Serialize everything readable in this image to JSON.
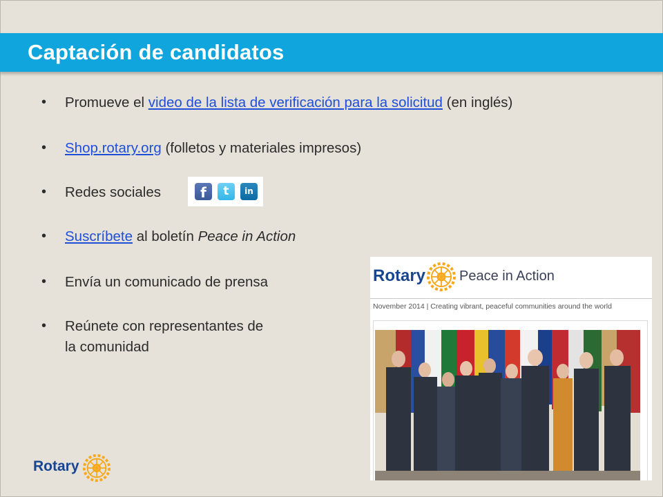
{
  "slide": {
    "title": "Captación de candidatos",
    "colors": {
      "title_bar": "#10a5dc",
      "link": "#1f4fd9",
      "rotary_blue": "#17458f",
      "rotary_gold": "#f7a81b"
    }
  },
  "bullets": [
    {
      "prefix": "Promueve el ",
      "link": "video de la lista de verificación para la solicitud",
      "suffix": " (en inglés)"
    },
    {
      "prefix": "",
      "link": "Shop.rotary.org",
      "suffix": " (folletos y materiales impresos)"
    },
    {
      "prefix": "Redes sociales",
      "link": "",
      "suffix": ""
    },
    {
      "prefix": "",
      "link": "Suscríbete",
      "suffix": " al boletín ",
      "italic": "Peace  in Action"
    },
    {
      "prefix": "Envía un comunicado de prensa",
      "link": "",
      "suffix": ""
    },
    {
      "prefix": "Reúnete con representantes de",
      "line2": "la comunidad"
    }
  ],
  "bullet_symbol": "•",
  "social_icons": [
    {
      "name": "facebook-icon",
      "glyph": "f"
    },
    {
      "name": "twitter-icon",
      "glyph": "t"
    },
    {
      "name": "linkedin-icon",
      "glyph": "in"
    }
  ],
  "newsletter": {
    "brand": "Rotary",
    "title": "Peace in Action",
    "date_line": "November 2014 | Creating vibrant, peaceful communities around the world"
  },
  "footer": {
    "brand": "Rotary"
  }
}
